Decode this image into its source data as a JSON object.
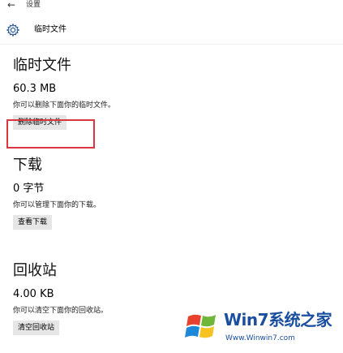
{
  "app": {
    "back_glyph": "←",
    "title": "设置"
  },
  "header": {
    "icon": "gear-icon",
    "title": "临时文件"
  },
  "sections": [
    {
      "title": "临时文件",
      "size": "60.3 MB",
      "description": "你可以删除下面你的临时文件。",
      "button": "删除临时文件"
    },
    {
      "title": "下载",
      "size": "0 字节",
      "description": "你可以管理下面你的下载。",
      "button": "查看下载"
    },
    {
      "title": "回收站",
      "size": "4.00 KB",
      "description": "你可以清空下面你的回收站。",
      "button": "清空回收站"
    }
  ],
  "watermark": {
    "main": "Win7系统之家",
    "url": "Www.Winwin7.com"
  },
  "colors": {
    "highlight": "#d9363e",
    "button_bg": "#e6e6e6",
    "accent": "#1a4fa0"
  }
}
